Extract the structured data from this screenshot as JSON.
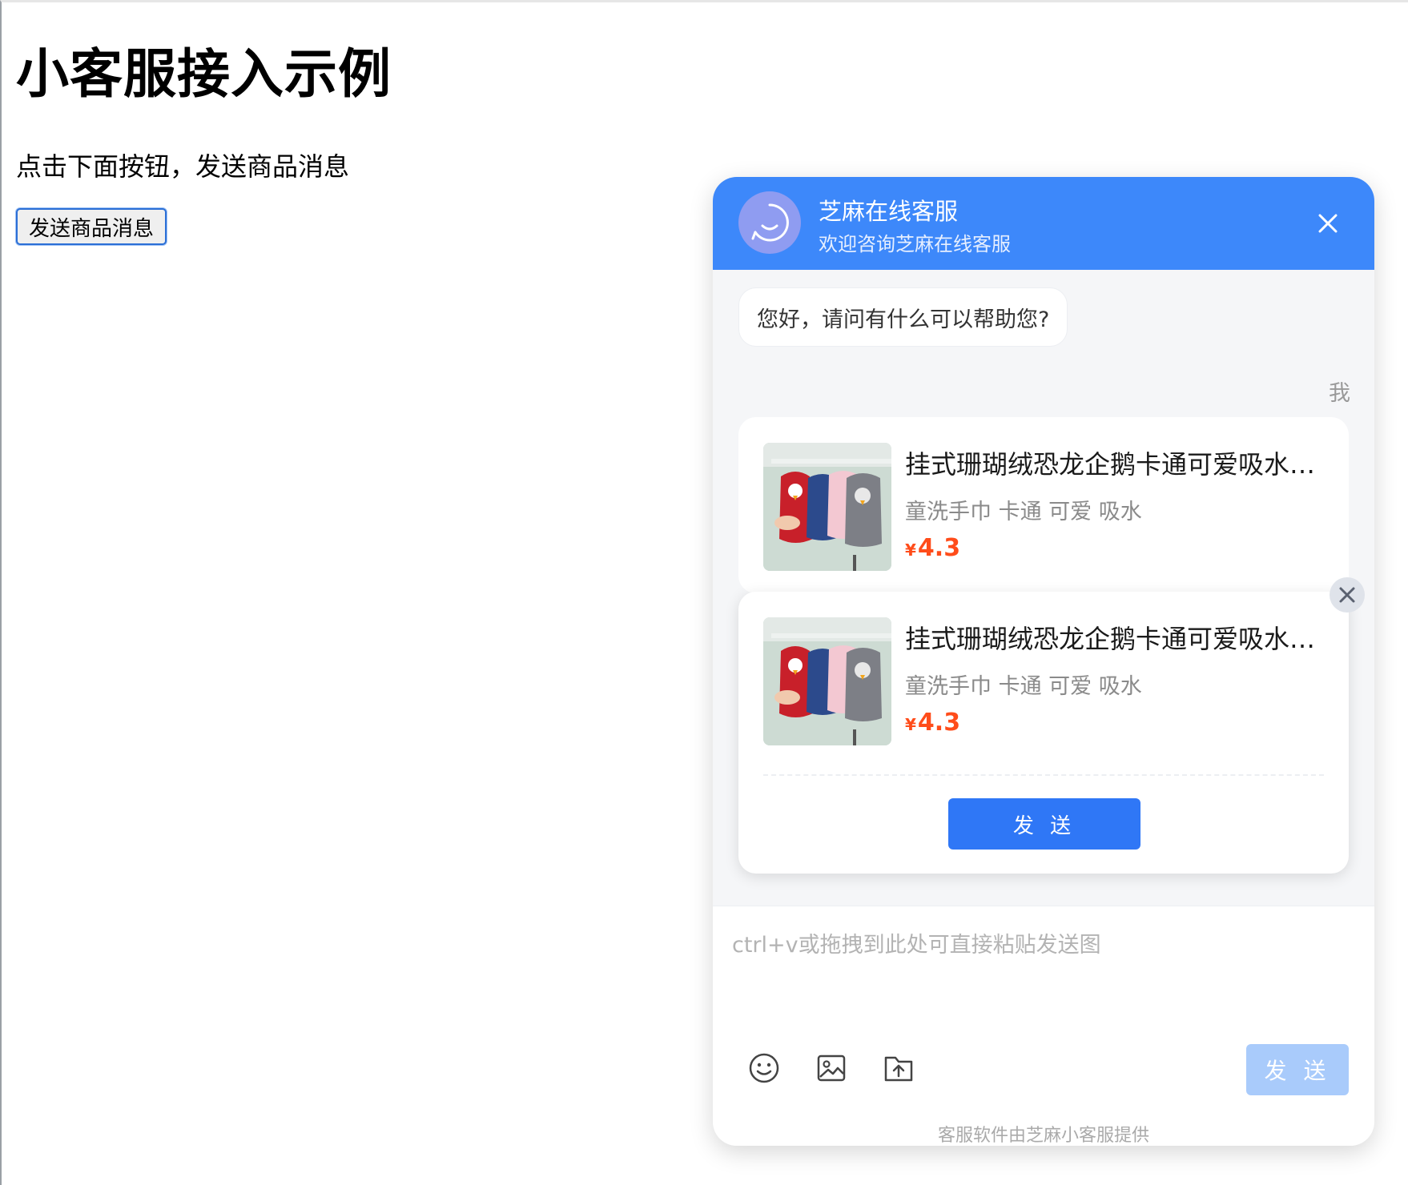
{
  "page": {
    "title": "小客服接入示例",
    "description": "点击下面按钮，发送商品消息",
    "button_label": "发送商品消息"
  },
  "chat": {
    "header": {
      "title": "芝麻在线客服",
      "subtitle": "欢迎咨询芝麻在线客服"
    },
    "welcome_message": "您好，请问有什么可以帮助您?",
    "sender_label": "我",
    "product": {
      "title": "挂式珊瑚绒恐龙企鹅卡通可爱吸水儿童洗手巾",
      "tags": "童洗手巾 卡通 可爱 吸水",
      "currency": "¥",
      "price": "4.3"
    },
    "card_send_label": "发 送",
    "input_placeholder": "ctrl+v或拖拽到此处可直接粘贴发送图",
    "send_label": "发 送",
    "footer": "客服软件由芝麻小客服提供"
  },
  "colors": {
    "header_bg": "#3d88fa",
    "card_send_bg": "#2f77f6",
    "send_disabled_bg": "#a9cbfb",
    "price": "#ff4c1a"
  }
}
